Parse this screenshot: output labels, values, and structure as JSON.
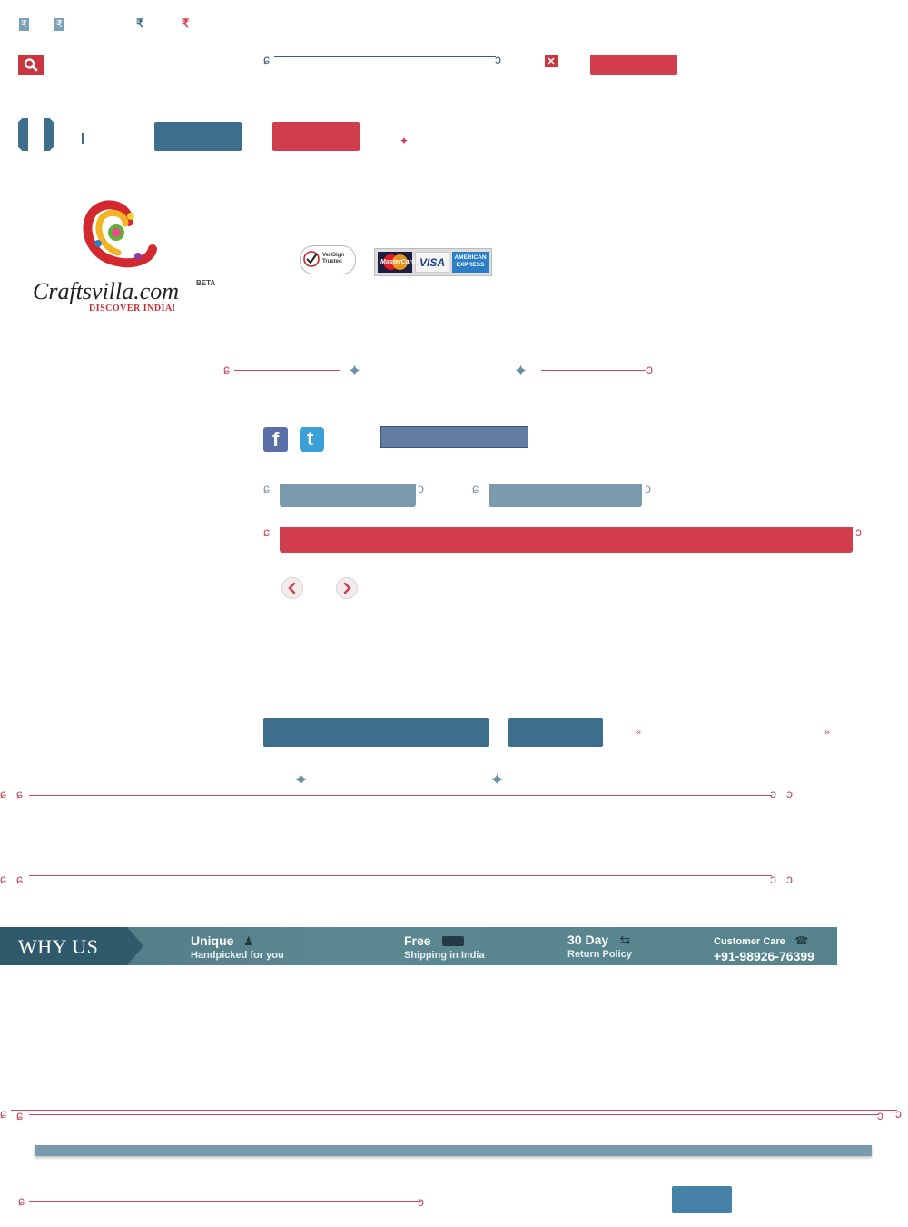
{
  "currency": {
    "symbols": [
      "₹",
      "₹",
      "₹",
      "₹"
    ],
    "colors": {
      "blue": "#7d9fb8",
      "red": "#d23d4d"
    }
  },
  "icons": {
    "search": "search-icon",
    "close": "close-icon",
    "facebook": "facebook-icon",
    "twitter": "twitter-icon",
    "prev": "chevron-left-icon",
    "next": "chevron-right-icon"
  },
  "brand": {
    "name": "Craftsvilla.com",
    "tag": "BETA",
    "tagline": "DISCOVER INDIA!",
    "colors": {
      "primary_blue": "#3d6f8d",
      "primary_red": "#d23d4d",
      "ornament_red": "#c9485a"
    }
  },
  "trust": {
    "verisign": "VeriSign Trusted",
    "cards": [
      "MasterCard",
      "VISA",
      "AMERICAN EXPRESS"
    ]
  },
  "why_us": {
    "title": "WHY US",
    "items": [
      {
        "heading": "Unique",
        "sub": "Handpicked for you"
      },
      {
        "heading": "Free",
        "sub": "Shipping in India"
      },
      {
        "heading": "30 Day",
        "sub": "Return Policy"
      },
      {
        "heading": "Customer Care",
        "sub": "+91-98926-76399"
      }
    ]
  }
}
